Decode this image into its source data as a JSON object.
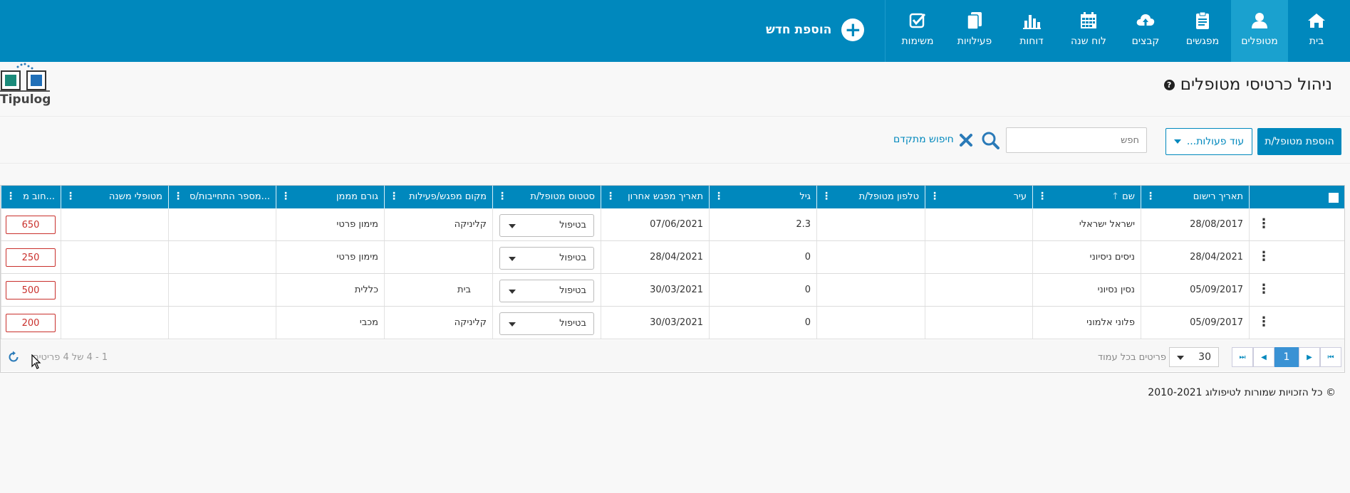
{
  "nav": {
    "items": [
      {
        "label": "בית",
        "icon": "home-icon",
        "active": false
      },
      {
        "label": "מטופלים",
        "icon": "user-icon",
        "active": true
      },
      {
        "label": "מפגשים",
        "icon": "clipboard-icon",
        "active": false
      },
      {
        "label": "קבצים",
        "icon": "cloud-upload-icon",
        "active": false
      },
      {
        "label": "לוח שנה",
        "icon": "calendar-icon",
        "active": false
      },
      {
        "label": "דוחות",
        "icon": "bar-chart-icon",
        "active": false
      },
      {
        "label": "פעילויות",
        "icon": "copy-icon",
        "active": false
      },
      {
        "label": "משימות",
        "icon": "checkbox-icon",
        "active": false
      }
    ],
    "add_new_label": "הוספת חדש"
  },
  "logo_text": "Tipulog",
  "page_title": "ניהול כרטיסי מטופלים",
  "toolbar": {
    "add_patient_label": "הוספת מטופל/ת",
    "more_actions_label": "עוד פעולות...",
    "search_placeholder": "חפש",
    "advanced_search_label": "חיפוש מתקדם"
  },
  "table": {
    "columns": [
      "תאריך רישום",
      "שם",
      "עיר",
      "טלפון מטופל/ת",
      "גיל",
      "תאריך מפגש אחרון",
      "סטטוס מטופל/ת",
      "מקום מפגש/פעילות",
      "גורם מממן",
      "מספר התחייבות/ס...",
      "מטופלי משנה",
      "חוב מ..."
    ],
    "sort_indicator": "↑",
    "rows": [
      {
        "reg_date": "28/08/2017",
        "name": "ישראל ישראלי",
        "city": "",
        "phone": "",
        "age": "2.3",
        "last_meeting": "07/06/2021",
        "status": "בטיפול",
        "place": "קליניקה",
        "funder": "מימון פרטי",
        "commitment": "",
        "sub_patients": "",
        "debt": "650"
      },
      {
        "reg_date": "28/04/2021",
        "name": "ניסים ניסיוני",
        "city": "",
        "phone": "",
        "age": "0",
        "last_meeting": "28/04/2021",
        "status": "בטיפול",
        "place": "",
        "funder": "מימון פרטי",
        "commitment": "",
        "sub_patients": "",
        "debt": "250"
      },
      {
        "reg_date": "05/09/2017",
        "name": "נסין נסיוני",
        "city": "",
        "phone": "",
        "age": "0",
        "last_meeting": "30/03/2021",
        "status": "בטיפול",
        "place": "בית",
        "funder": "כללית",
        "commitment": "",
        "sub_patients": "",
        "debt": "500"
      },
      {
        "reg_date": "05/09/2017",
        "name": "פלוני אלמוני",
        "city": "",
        "phone": "",
        "age": "0",
        "last_meeting": "30/03/2021",
        "status": "בטיפול",
        "place": "קליניקה",
        "funder": "מכבי",
        "commitment": "",
        "sub_patients": "",
        "debt": "200"
      }
    ]
  },
  "pager": {
    "current_page": "1",
    "page_size": "30",
    "page_size_label": "פריטים בכל עמוד",
    "items_info": "1 - 4 של 4 פריטים"
  },
  "footer": "© כל הזכויות שמורות לטיפולוג 2010-2021",
  "colors": {
    "primary": "#0088bd",
    "active_nav": "#1aa1cf",
    "debt": "#c9302c"
  }
}
